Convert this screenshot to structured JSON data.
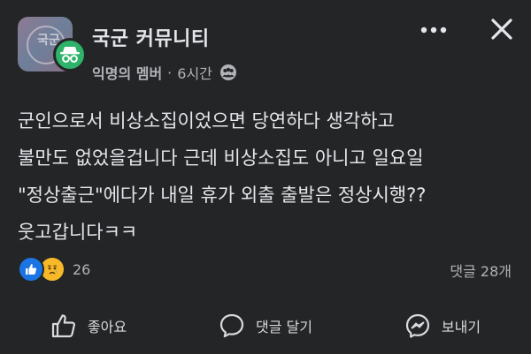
{
  "header": {
    "group_name": "국군 커뮤니티",
    "group_avatar_mark": "국군",
    "author": "익명의 멤버",
    "separator": "·",
    "time": "6시간",
    "icons": {
      "more": "more-dots-icon",
      "close": "close-icon",
      "badge": "incognito-icon",
      "privacy": "group-members-icon"
    }
  },
  "post": {
    "lines": [
      "군인으로서 비상소집이었으면 당연하다 생각하고",
      "불만도 없었을겁니다 근데 비상소집도 아니고 일요일",
      "\"정상출근\"에다가 내일 휴가 외출 출발은 정상시행??",
      "웃고갑니다ㅋㅋ"
    ]
  },
  "reactions": {
    "types": [
      "like",
      "sad"
    ],
    "count": "26",
    "comments": "댓글 28개"
  },
  "actions": {
    "like": "좋아요",
    "comment": "댓글 달기",
    "share": "보내기"
  },
  "colors": {
    "background": "#242526",
    "text": "#e4e6eb",
    "secondary": "#b0b3b8",
    "like_blue": "#1b74e4",
    "sad_yellow": "#f7b928",
    "anon_green": "#2fb36a"
  }
}
